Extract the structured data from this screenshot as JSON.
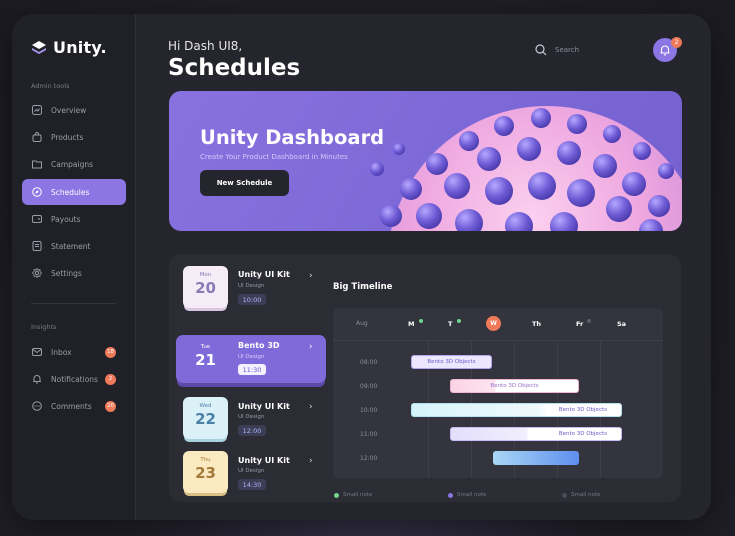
{
  "brand": {
    "name": "Unity."
  },
  "sidebar": {
    "admin_label": "Admin tools",
    "admin_items": [
      {
        "label": "Overview",
        "icon": "chart-icon"
      },
      {
        "label": "Products",
        "icon": "bag-icon"
      },
      {
        "label": "Campaigns",
        "icon": "folder-icon"
      },
      {
        "label": "Schedules",
        "icon": "compass-icon",
        "active": true
      },
      {
        "label": "Payouts",
        "icon": "wallet-icon"
      },
      {
        "label": "Statement",
        "icon": "document-icon"
      },
      {
        "label": "Settings",
        "icon": "gear-icon"
      }
    ],
    "insights_label": "Insights",
    "insight_items": [
      {
        "label": "Inbox",
        "icon": "mail-icon",
        "badge": "18"
      },
      {
        "label": "Notifications",
        "icon": "bell-icon",
        "badge": "2"
      },
      {
        "label": "Comments",
        "icon": "chat-icon",
        "badge": "20"
      }
    ]
  },
  "header": {
    "greeting": "Hi Dash UI8,",
    "title": "Schedules",
    "search_placeholder": "Search",
    "notification_count": "2"
  },
  "hero": {
    "title": "Unity Dashboard",
    "subtitle": "Create Your Product Dashboard in Minutes",
    "button": "New Schedule"
  },
  "schedule": [
    {
      "day": "Mon",
      "date": "20",
      "title": "Unity UI Kit",
      "sub": "UI Design",
      "time": "10:00",
      "card_bg": "#f6ecf7",
      "card_fg": "#8a7ab5"
    },
    {
      "day": "Tue",
      "date": "21",
      "title": "Bento 3D",
      "sub": "UI Design",
      "time": "11:30",
      "active": true
    },
    {
      "day": "Wed",
      "date": "22",
      "title": "Unity UI Kit",
      "sub": "UI Design",
      "time": "12:00",
      "card_bg": "#d9f1f7",
      "card_fg": "#4a7fa6"
    },
    {
      "day": "Thu",
      "date": "23",
      "title": "Unity UI Kit",
      "sub": "UI Design",
      "time": "14:30",
      "card_bg": "#fbe9bf",
      "card_fg": "#a47a3a"
    }
  ],
  "timeline": {
    "title": "Big Timeline",
    "month": "Aug",
    "days": [
      "M",
      "T",
      "W",
      "Th",
      "Fr",
      "Sa"
    ],
    "times": [
      "08:00",
      "09:00",
      "10:00",
      "11:00",
      "12:00"
    ],
    "bars": [
      {
        "label": "Bento 3D Objects"
      },
      {
        "label": "Bento 3D Objects"
      },
      {
        "label": "Bento 3D Objects"
      },
      {
        "label": "Bento 3D Objects"
      },
      {
        "label": ""
      }
    ],
    "legend": [
      "Small note",
      "Small note",
      "Small note"
    ]
  },
  "colors": {
    "accent": "#8b76e3",
    "badge": "#ef7a5a",
    "green": "#6fd38a"
  }
}
